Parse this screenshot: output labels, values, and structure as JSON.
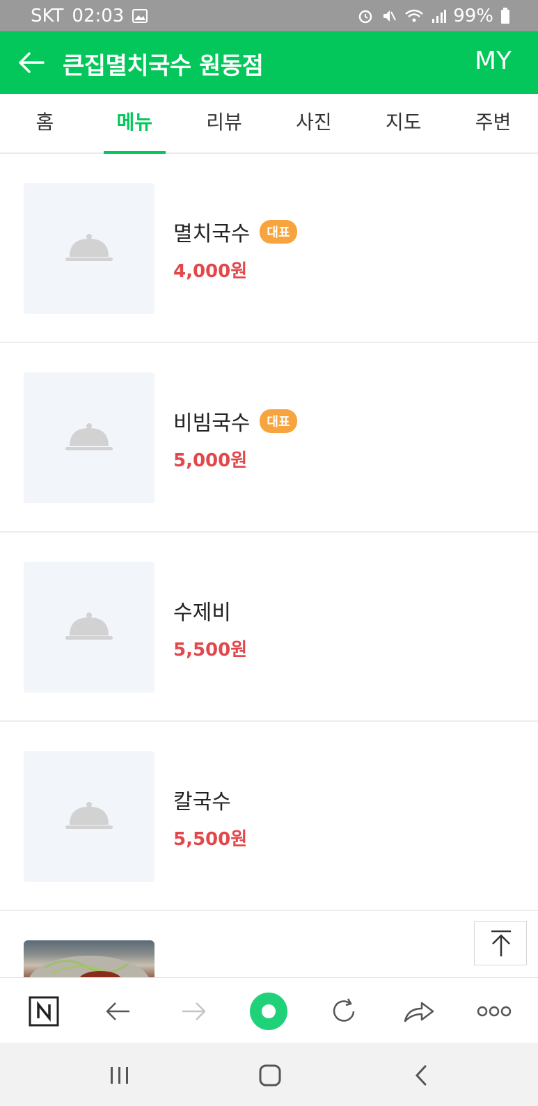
{
  "status_bar": {
    "carrier": "SKT",
    "time": "02:03",
    "battery": "99%"
  },
  "header": {
    "title": "큰집멸치국수 원동점",
    "my_label": "MY"
  },
  "tabs": [
    {
      "label": "홈",
      "active": false
    },
    {
      "label": "메뉴",
      "active": true
    },
    {
      "label": "리뷰",
      "active": false
    },
    {
      "label": "사진",
      "active": false
    },
    {
      "label": "지도",
      "active": false
    },
    {
      "label": "주변",
      "active": false
    }
  ],
  "menu_items": [
    {
      "name": "멸치국수",
      "badge": "대표",
      "price": "4,000원"
    },
    {
      "name": "비빔국수",
      "badge": "대표",
      "price": "5,000원"
    },
    {
      "name": "수제비",
      "badge": "",
      "price": "5,500원"
    },
    {
      "name": "칼국수",
      "badge": "",
      "price": "5,500원"
    }
  ],
  "colors": {
    "brand": "#03c75a",
    "price": "#e2474b",
    "badge": "#f7a43e",
    "status_bar": "#9a9a9a"
  },
  "icons": {
    "back": "arrow-left-icon",
    "placeholder": "food-cloche-icon",
    "scroll_top": "arrow-up-to-top-icon",
    "toolbar": [
      "naver-n-icon",
      "back-arrow-icon",
      "forward-arrow-icon",
      "green-dot-icon",
      "refresh-icon",
      "share-icon",
      "more-icon"
    ],
    "system_nav": [
      "recents-icon",
      "home-icon",
      "back-chevron-icon"
    ]
  }
}
